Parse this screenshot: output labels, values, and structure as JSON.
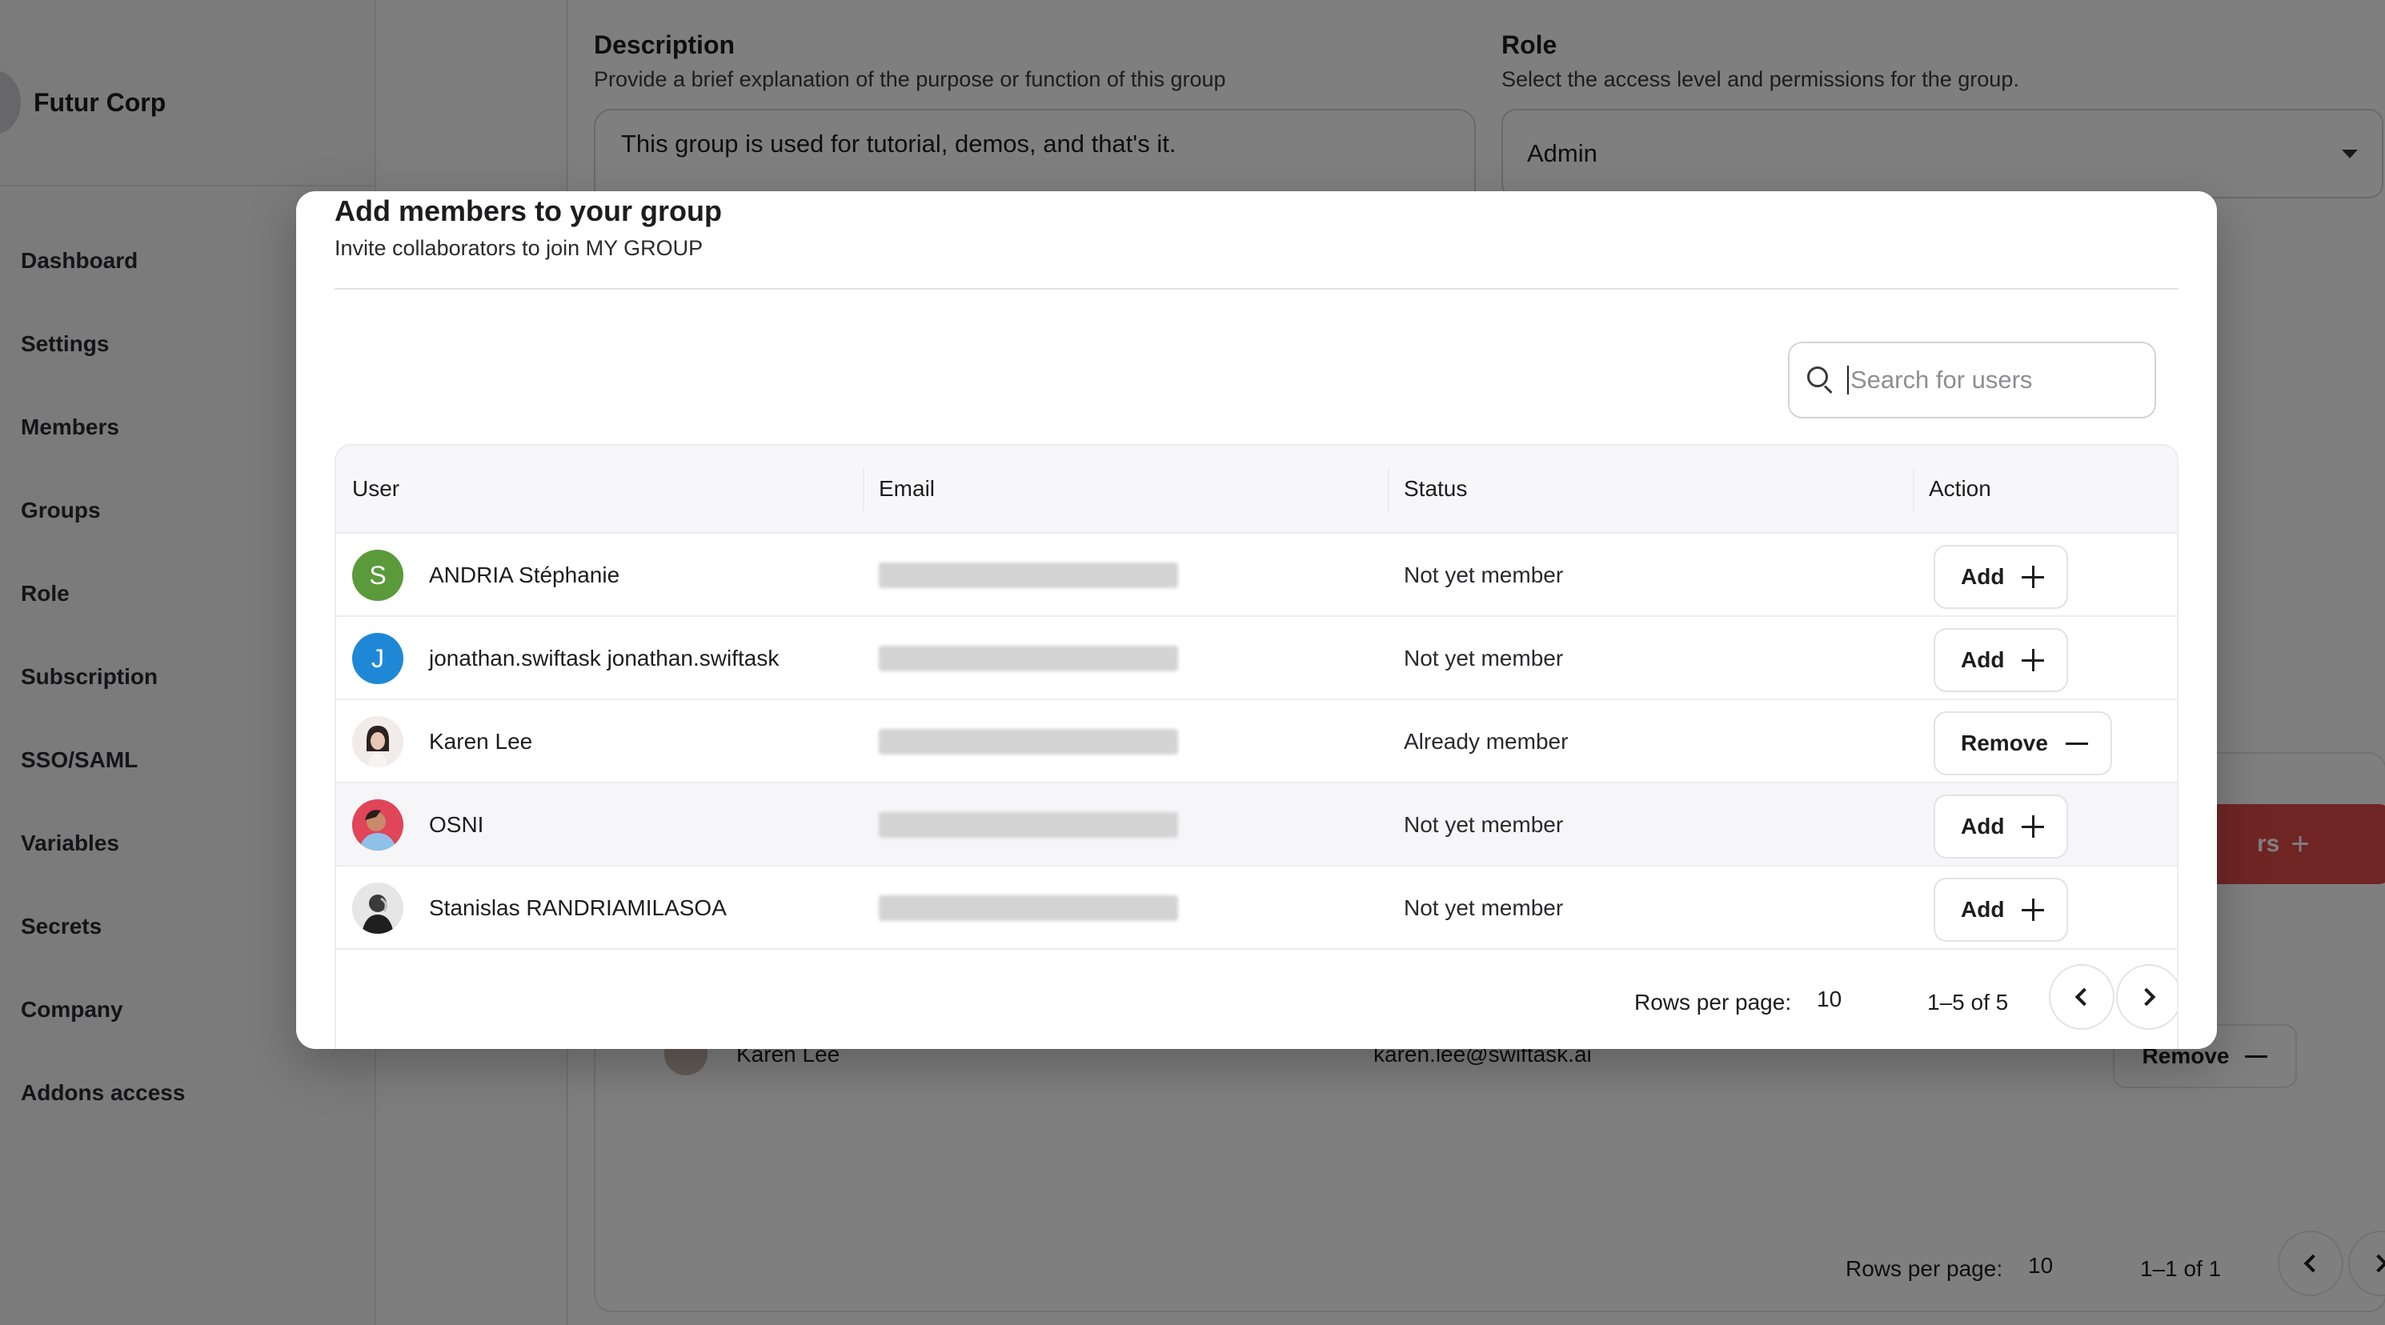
{
  "sidebar": {
    "org_name": "Futur Corp",
    "items": [
      {
        "label": "Dashboard"
      },
      {
        "label": "Settings"
      },
      {
        "label": "Members"
      },
      {
        "label": "Groups"
      },
      {
        "label": "Role"
      },
      {
        "label": "Subscription"
      },
      {
        "label": "SSO/SAML"
      },
      {
        "label": "Variables"
      },
      {
        "label": "Secrets"
      },
      {
        "label": "Company"
      },
      {
        "label": "Addons access"
      }
    ]
  },
  "background": {
    "description_title": "Description",
    "description_help": "Provide a brief explanation of the purpose or function of this group",
    "description_value": "This group is used for tutorial, demos, and that's it.",
    "role_title": "Role",
    "role_help": "Select the access level and permissions for the group.",
    "role_value": "Admin",
    "add_members_label": "rs",
    "member_row": {
      "name": "Karen Lee",
      "email": "karen.lee@swiftask.ai",
      "action": "Remove"
    },
    "footer": {
      "rows_per_page_label": "Rows per page:",
      "rows_per_page_value": "10",
      "range": "1–1 of 1"
    }
  },
  "modal": {
    "title": "Add members to your group",
    "subtitle": "Invite collaborators to join MY GROUP",
    "search_placeholder": "Search for users",
    "columns": {
      "user": "User",
      "email": "Email",
      "status": "Status",
      "action": "Action"
    },
    "rows": [
      {
        "avatar_letter": "S",
        "avatar_color": "#5a9a3a",
        "name": "ANDRIA Stéphanie",
        "status": "Not yet member",
        "action": "Add"
      },
      {
        "avatar_letter": "J",
        "avatar_color": "#1e88d6",
        "name": "jonathan.swiftask jonathan.swiftask",
        "status": "Not yet member",
        "action": "Add"
      },
      {
        "avatar_letter": "",
        "avatar_color": "#e8e0dc",
        "name": "Karen Lee",
        "status": "Already member",
        "action": "Remove"
      },
      {
        "avatar_letter": "",
        "avatar_color": "#e0455a",
        "name": "OSNI",
        "status": "Not yet member",
        "action": "Add"
      },
      {
        "avatar_letter": "",
        "avatar_color": "#4a4a4a",
        "name": "Stanislas RANDRIAMILASOA",
        "status": "Not yet member",
        "action": "Add"
      }
    ],
    "footer": {
      "rows_per_page_label": "Rows per page:",
      "rows_per_page_value": "10",
      "range": "1–5 of 5"
    }
  },
  "colors": {
    "accent_red": "#e14b4b",
    "overlay": "rgba(0,0,0,0.5)"
  }
}
